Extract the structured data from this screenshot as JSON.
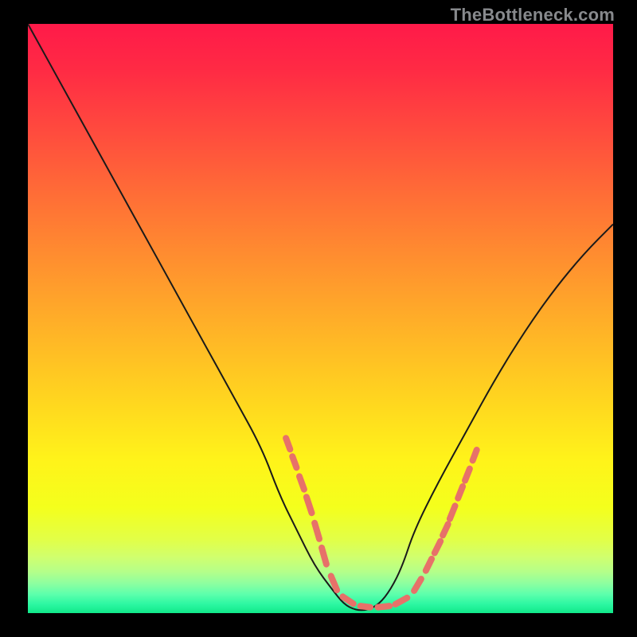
{
  "watermark": "TheBottleneck.com",
  "chart_data": {
    "type": "line",
    "title": "",
    "xlabel": "",
    "ylabel": "",
    "xlim": [
      0,
      100
    ],
    "ylim": [
      0,
      100
    ],
    "series": [
      {
        "name": "bottleneck-curve",
        "x": [
          0,
          5,
          10,
          15,
          20,
          25,
          30,
          35,
          40,
          43,
          46,
          49,
          52,
          54,
          56,
          58,
          60,
          62,
          64,
          66,
          70,
          75,
          80,
          85,
          90,
          95,
          100
        ],
        "y": [
          100,
          91,
          82,
          73,
          64,
          55,
          46,
          37,
          28,
          20,
          14,
          8,
          4,
          1.5,
          0.5,
          0.5,
          1.5,
          4,
          8,
          14,
          22,
          31,
          40,
          48,
          55,
          61,
          66
        ]
      }
    ],
    "highlight_dashes": {
      "comment": "salmon dotted segments near valley edges, given as fractional positions in the plot box (0..1 from top-left)",
      "segments": [
        {
          "x1": 0.441,
          "y1": 0.703,
          "x2": 0.448,
          "y2": 0.722
        },
        {
          "x1": 0.452,
          "y1": 0.734,
          "x2": 0.459,
          "y2": 0.753
        },
        {
          "x1": 0.464,
          "y1": 0.768,
          "x2": 0.472,
          "y2": 0.79
        },
        {
          "x1": 0.476,
          "y1": 0.803,
          "x2": 0.485,
          "y2": 0.83
        },
        {
          "x1": 0.49,
          "y1": 0.847,
          "x2": 0.498,
          "y2": 0.874
        },
        {
          "x1": 0.502,
          "y1": 0.889,
          "x2": 0.51,
          "y2": 0.917
        },
        {
          "x1": 0.518,
          "y1": 0.937,
          "x2": 0.528,
          "y2": 0.961
        },
        {
          "x1": 0.538,
          "y1": 0.972,
          "x2": 0.556,
          "y2": 0.984
        },
        {
          "x1": 0.568,
          "y1": 0.988,
          "x2": 0.585,
          "y2": 0.99
        },
        {
          "x1": 0.598,
          "y1": 0.99,
          "x2": 0.618,
          "y2": 0.988
        },
        {
          "x1": 0.628,
          "y1": 0.985,
          "x2": 0.648,
          "y2": 0.974
        },
        {
          "x1": 0.66,
          "y1": 0.962,
          "x2": 0.672,
          "y2": 0.942
        },
        {
          "x1": 0.68,
          "y1": 0.928,
          "x2": 0.69,
          "y2": 0.908
        },
        {
          "x1": 0.695,
          "y1": 0.898,
          "x2": 0.705,
          "y2": 0.878
        },
        {
          "x1": 0.709,
          "y1": 0.868,
          "x2": 0.718,
          "y2": 0.849
        },
        {
          "x1": 0.721,
          "y1": 0.84,
          "x2": 0.73,
          "y2": 0.818
        },
        {
          "x1": 0.735,
          "y1": 0.805,
          "x2": 0.743,
          "y2": 0.785
        },
        {
          "x1": 0.747,
          "y1": 0.775,
          "x2": 0.755,
          "y2": 0.755
        },
        {
          "x1": 0.76,
          "y1": 0.741,
          "x2": 0.767,
          "y2": 0.723
        }
      ],
      "color": "#e77169"
    },
    "gradient_stops": [
      {
        "offset": 0.0,
        "color": "#ff1a49"
      },
      {
        "offset": 0.08,
        "color": "#ff2b44"
      },
      {
        "offset": 0.18,
        "color": "#ff4a3e"
      },
      {
        "offset": 0.28,
        "color": "#ff6a37"
      },
      {
        "offset": 0.4,
        "color": "#ff8f2f"
      },
      {
        "offset": 0.52,
        "color": "#ffb327"
      },
      {
        "offset": 0.64,
        "color": "#ffd61f"
      },
      {
        "offset": 0.74,
        "color": "#fff31a"
      },
      {
        "offset": 0.82,
        "color": "#f4ff1c"
      },
      {
        "offset": 0.875,
        "color": "#e2ff47"
      },
      {
        "offset": 0.905,
        "color": "#d0ff6e"
      },
      {
        "offset": 0.93,
        "color": "#b4ff8a"
      },
      {
        "offset": 0.95,
        "color": "#8cffa0"
      },
      {
        "offset": 0.968,
        "color": "#5cffac"
      },
      {
        "offset": 0.985,
        "color": "#2cf7a2"
      },
      {
        "offset": 1.0,
        "color": "#11e889"
      }
    ],
    "colors": {
      "curve": "#1a1a1a",
      "dash": "#e77169",
      "frame_bg": "#000000"
    }
  }
}
